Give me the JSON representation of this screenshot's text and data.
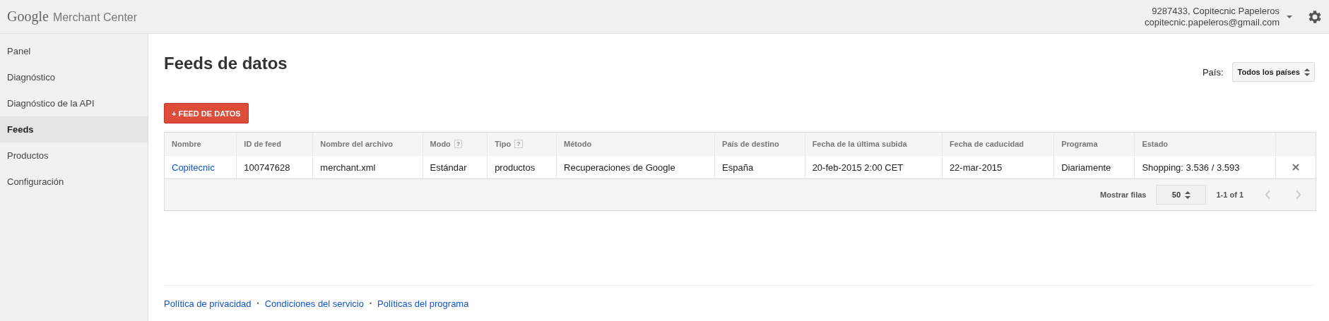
{
  "header": {
    "logo_word": "Google",
    "product": "Merchant Center",
    "account_line": "9287433, Copitecnic Papeleros",
    "email": "copitecnic.papeleros@gmail.com"
  },
  "sidebar": {
    "items": [
      {
        "label": "Panel",
        "selected": false
      },
      {
        "label": "Diagnóstico",
        "selected": false
      },
      {
        "label": "Diagnóstico de la API",
        "selected": false
      },
      {
        "label": "Feeds",
        "selected": true
      },
      {
        "label": "Productos",
        "selected": false
      },
      {
        "label": "Configuración",
        "selected": false
      }
    ]
  },
  "page": {
    "title": "Feeds de datos",
    "country_label": "País:",
    "country_value": "Todos los países",
    "add_button": "+ FEED DE DATOS"
  },
  "table": {
    "columns": [
      {
        "label": "Nombre"
      },
      {
        "label": "ID de feed"
      },
      {
        "label": "Nombre del archivo"
      },
      {
        "label": "Modo",
        "help": "?"
      },
      {
        "label": "Tipo",
        "help": "?"
      },
      {
        "label": "Método"
      },
      {
        "label": "País de destino"
      },
      {
        "label": "Fecha de la última subida"
      },
      {
        "label": "Fecha de caducidad"
      },
      {
        "label": "Programa"
      },
      {
        "label": "Estado"
      }
    ],
    "rows": [
      {
        "cells": [
          "Copitecnic",
          "100747628",
          "merchant.xml",
          "Estándar",
          "productos",
          "Recuperaciones de Google",
          "España",
          "20-feb-2015 2:00 CET",
          "22-mar-2015",
          "Diariamente",
          "Shopping: 3.536 / 3.593"
        ]
      }
    ],
    "rows_label": "Mostrar filas",
    "rows_value": "50",
    "range": "1-1 of 1"
  },
  "footer": {
    "items": [
      {
        "kind": "link",
        "text": "Política de privacidad"
      },
      {
        "kind": "separator",
        "text": "•"
      },
      {
        "kind": "link",
        "text": "Condiciones del servicio"
      },
      {
        "kind": "separator",
        "text": "•"
      },
      {
        "kind": "link",
        "text": "Políticas del programa"
      }
    ]
  }
}
